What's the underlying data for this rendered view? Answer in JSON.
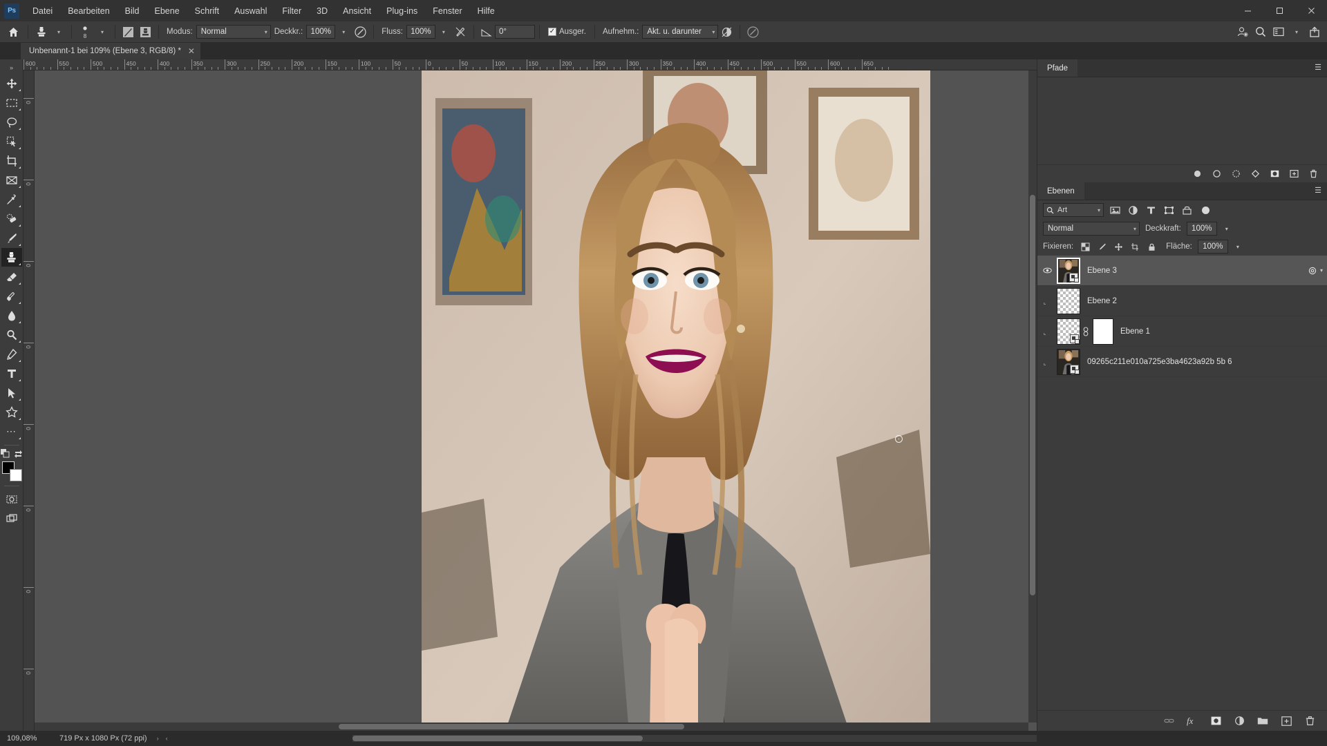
{
  "app": {
    "logo": "Ps",
    "menus": [
      "Datei",
      "Bearbeiten",
      "Bild",
      "Ebene",
      "Schrift",
      "Auswahl",
      "Filter",
      "3D",
      "Ansicht",
      "Plug-ins",
      "Fenster",
      "Hilfe"
    ],
    "window_controls": {
      "minimize": "─",
      "maximize": "□",
      "close": "✕"
    }
  },
  "options_bar": {
    "home_icon": "home-icon",
    "tool_icon": "clone-stamp-icon",
    "brush_size": "8",
    "toggle_brush_panel": "brush-panel-icon",
    "toggle_clone_source": "clone-source-icon",
    "mode_label": "Modus:",
    "mode_value": "Normal",
    "opacity_label": "Deckkr.:",
    "opacity_value": "100%",
    "airbrush_icon": "airbrush-icon",
    "flow_label": "Fluss:",
    "flow_value": "100%",
    "smoothing_icon": "tilt-pressure-icon",
    "angle_icon": "angle-icon",
    "angle_value": "0°",
    "aligned_label": "Ausger.",
    "aligned_checked": true,
    "sample_label": "Aufnehm.:",
    "sample_value": "Akt. u. darunter",
    "ignore_adjust_icon": "ignore-adjustment-layers-icon",
    "pressure_icon": "pressure-size-icon",
    "right_icons": [
      "user-add-icon",
      "search-icon",
      "workspace-icon",
      "chevron-down-icon",
      "share-icon"
    ]
  },
  "document_tab": {
    "title": "Unbenannt-1 bei 109% (Ebene 3, RGB/8) *",
    "close": "✕"
  },
  "toolbar": {
    "tools": [
      {
        "name": "move-tool",
        "glyph": "move"
      },
      {
        "name": "rectangular-marquee-tool",
        "glyph": "marquee"
      },
      {
        "name": "lasso-tool",
        "glyph": "lasso"
      },
      {
        "name": "quick-selection-tool",
        "glyph": "quickselect"
      },
      {
        "name": "crop-tool",
        "glyph": "crop"
      },
      {
        "name": "frame-tool",
        "glyph": "frame"
      },
      {
        "name": "eyedropper-tool",
        "glyph": "eyedropper"
      },
      {
        "name": "spot-healing-brush-tool",
        "glyph": "healing"
      },
      {
        "name": "brush-tool",
        "glyph": "brush"
      },
      {
        "name": "clone-stamp-tool",
        "glyph": "stamp",
        "active": true
      },
      {
        "name": "eraser-tool",
        "glyph": "eraser"
      },
      {
        "name": "gradient-tool",
        "glyph": "gradient"
      },
      {
        "name": "blur-tool",
        "glyph": "blur"
      },
      {
        "name": "dodge-tool",
        "glyph": "dodge"
      },
      {
        "name": "pen-tool",
        "glyph": "pen"
      },
      {
        "name": "type-tool",
        "glyph": "type"
      },
      {
        "name": "path-selection-tool",
        "glyph": "pathselect"
      },
      {
        "name": "custom-shape-tool",
        "glyph": "shape"
      },
      {
        "name": "edit-toolbar-button",
        "glyph": "dots"
      }
    ],
    "quickmask_icon": "quick-mask-icon",
    "screenmode_icon": "screen-mode-icon",
    "swap_colors_icon": "swap-colors-icon",
    "default_colors_icon": "default-colors-icon",
    "foreground_color": "#000000",
    "background_color": "#ffffff"
  },
  "ruler": {
    "unit": "px",
    "h_labels": [
      "600",
      "550",
      "500",
      "450",
      "400",
      "350",
      "300",
      "250",
      "200",
      "150",
      "100",
      "50",
      "0",
      "50",
      "100",
      "150",
      "200",
      "250",
      "300",
      "350",
      "400",
      "450",
      "500",
      "550",
      "600",
      "650"
    ],
    "v_labels": [
      "0",
      "0",
      "0",
      "0",
      "0",
      "0",
      "0",
      "0"
    ]
  },
  "paths_panel": {
    "tab": "Pfade",
    "menu_icon": "panel-menu-icon",
    "footer_icons": [
      "fill-path-icon",
      "stroke-path-icon",
      "load-selection-icon",
      "make-work-path-icon",
      "mask-icon",
      "new-path-icon",
      "delete-path-icon"
    ]
  },
  "layers_panel": {
    "tab": "Ebenen",
    "menu_icon": "panel-menu-icon",
    "filter_value": "Art",
    "filter_icons": [
      "pixel-filter-icon",
      "adjustment-filter-icon",
      "type-filter-icon",
      "shape-filter-icon",
      "smart-object-filter-icon"
    ],
    "filter_toggle": "filter-enable-toggle",
    "blend_mode": "Normal",
    "opacity_label": "Deckkraft:",
    "opacity_value": "100%",
    "lock_label": "Fixieren:",
    "lock_icons": [
      "lock-transparent-pixels-icon",
      "lock-image-pixels-icon",
      "lock-position-icon",
      "lock-artboard-icon",
      "lock-all-icon"
    ],
    "fill_label": "Fläche:",
    "fill_value": "100%",
    "layers": [
      {
        "name": "Ebene 3",
        "visible": true,
        "selected": true,
        "thumb": "photo",
        "smart_object": true,
        "has_mask": false,
        "right_icons": [
          "layer-effects-icon",
          "expand-chevron-icon"
        ]
      },
      {
        "name": "Ebene 2",
        "visible": false,
        "selected": false,
        "thumb": "transparent",
        "smart_object": false,
        "has_mask": false,
        "right_icons": []
      },
      {
        "name": "Ebene 1",
        "visible": false,
        "selected": false,
        "thumb": "transparent",
        "smart_object": true,
        "has_mask": true,
        "right_icons": []
      },
      {
        "name": "09265c211e010a725e3ba4623a92b 5b 6",
        "visible": false,
        "selected": false,
        "thumb": "photo",
        "smart_object": true,
        "has_mask": false,
        "right_icons": []
      }
    ],
    "footer_icons": [
      "link-layers-icon",
      "add-layer-style-icon",
      "add-layer-mask-icon",
      "new-adjustment-layer-icon",
      "new-group-icon",
      "new-layer-icon",
      "delete-layer-icon"
    ]
  },
  "status_bar": {
    "zoom": "109,08%",
    "doc_size": "719 Px x 1080 Px (72 ppi)",
    "next_arrow": "›",
    "prev_arrow": "‹"
  }
}
